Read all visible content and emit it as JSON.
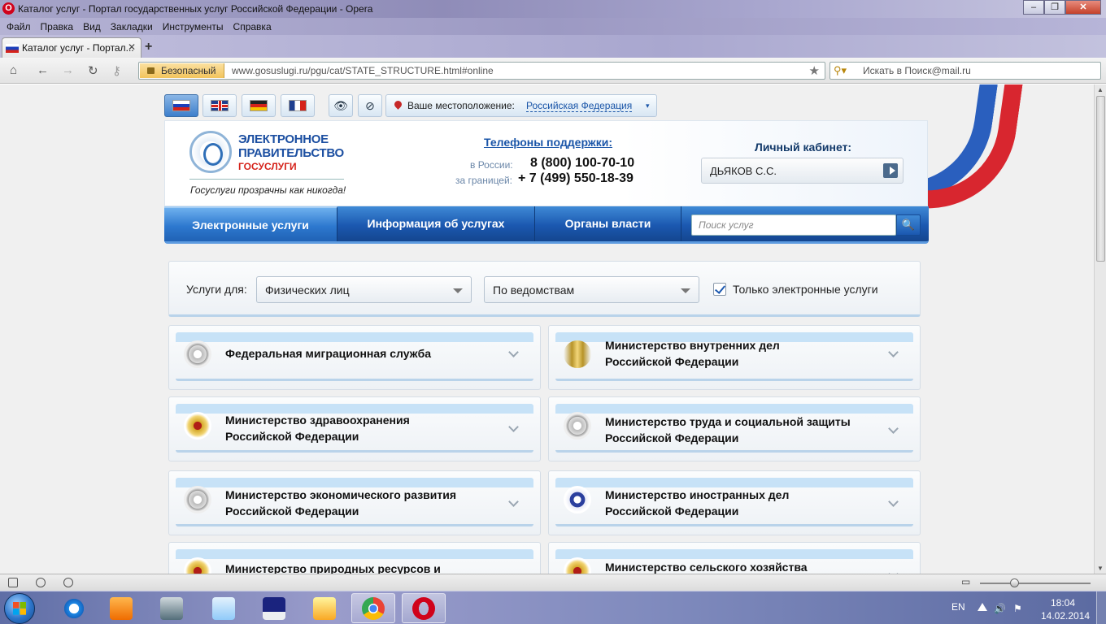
{
  "window": {
    "title": "Каталог услуг - Портал государственных услуг Российской Федерации - Opera",
    "controls": [
      "minimize-icon",
      "maximize-icon",
      "close-icon"
    ]
  },
  "menu": [
    "Файл",
    "Правка",
    "Вид",
    "Закладки",
    "Инструменты",
    "Справка"
  ],
  "tab": {
    "title": "Каталог услуг - Портал..."
  },
  "addressbar": {
    "security_label": "Безопасный",
    "url": "www.gosuslugi.ru/pgu/cat/STATE_STRUCTURE.html#online",
    "search_placeholder": "Искать в Поиск@mail.ru"
  },
  "site": {
    "location_label": "Ваше местоположение:",
    "location_value": "Российская Федерация",
    "logo_line1": "ЭЛЕКТРОННОЕ",
    "logo_line2": "ПРАВИТЕЛЬСТВО",
    "logo_line3": "ГОСУСЛУГИ",
    "motto": "Госуслуги прозрачны как никогда!",
    "phones_title": "Телефоны поддержки:",
    "phone_ru_label": "в России:",
    "phone_ru": "8 (800) 100-70-10",
    "phone_abroad_label": "за границей:",
    "phone_abroad": "+ 7 (499) 550-18-39",
    "cabinet_title": "Личный кабинет:",
    "cabinet_user": "ДЬЯКОВ С.С.",
    "nav": [
      "Электронные услуги",
      "Информация об услугах",
      "Органы власти"
    ],
    "search_placeholder": "Поиск услуг"
  },
  "filters": {
    "label": "Услуги для:",
    "audience": "Физических лиц",
    "grouping": "По ведомствам",
    "electronic_only_label": "Только электронные услуги",
    "electronic_only_checked": true
  },
  "agencies": {
    "a0": {
      "line1": "Федеральная миграционная служба",
      "line2": ""
    },
    "a1": {
      "line1": "Министерство внутренних дел",
      "line2": "Российской Федерации"
    },
    "a2": {
      "line1": "Министерство здравоохранения",
      "line2": "Российской Федерации"
    },
    "a3": {
      "line1": "Министерство труда и социальной защиты",
      "line2": "Российской Федерации"
    },
    "a4": {
      "line1": "Министерство экономического развития",
      "line2": "Российской Федерации"
    },
    "a5": {
      "line1": "Министерство иностранных дел",
      "line2": "Российской Федерации"
    },
    "a6": {
      "line1": "Министерство природных ресурсов и",
      "line2": ""
    },
    "a7": {
      "line1": "Министерство сельского хозяйства",
      "line2": ""
    }
  },
  "taskbar": {
    "language": "EN",
    "time": "18:04",
    "date": "14.02.2014"
  }
}
